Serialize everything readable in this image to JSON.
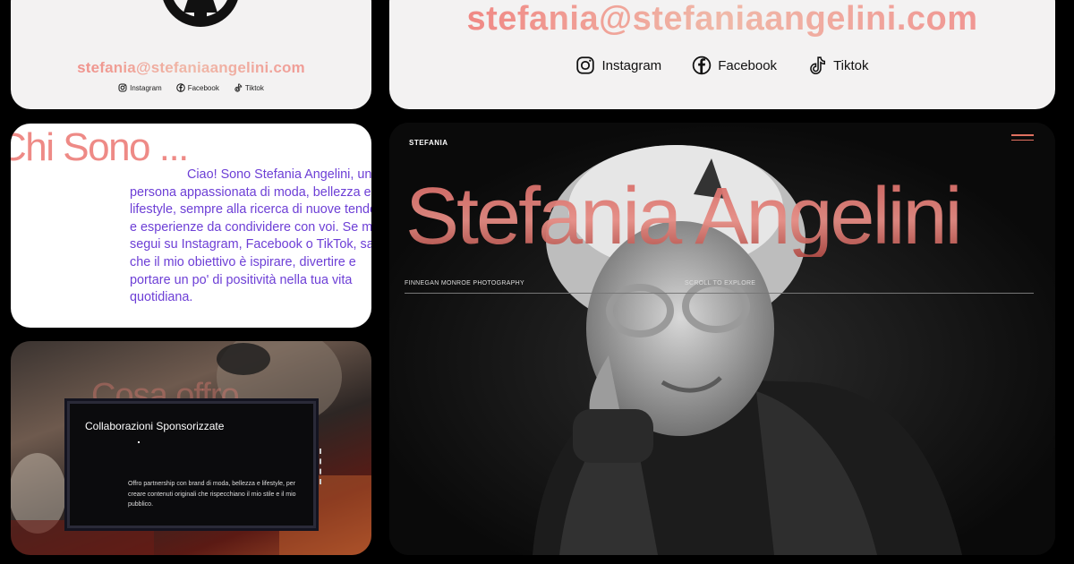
{
  "contact_small": {
    "email": "stefania@stefaniaangelini.com",
    "socials": [
      {
        "label": "Instagram",
        "icon": "instagram-icon"
      },
      {
        "label": "Facebook",
        "icon": "facebook-icon"
      },
      {
        "label": "Tiktok",
        "icon": "tiktok-icon"
      }
    ]
  },
  "contact_large": {
    "email": "stefania@stefaniaangelini.com",
    "socials": [
      {
        "label": "Instagram",
        "icon": "instagram-icon"
      },
      {
        "label": "Facebook",
        "icon": "facebook-icon"
      },
      {
        "label": "Tiktok",
        "icon": "tiktok-icon"
      }
    ]
  },
  "about": {
    "heading": "Chi Sono ...",
    "lines": [
      "                Ciao! Sono Stefania Angelini, una",
      "persona appassionata di moda, bellezza e",
      "lifestyle, sempre alla ricerca di nuove tendenze",
      "e esperienze da condividere con voi. Se mi",
      "segui su Instagram, Facebook o TikTok, sai",
      "che il mio obiettivo è ispirare, divertire e",
      "portare un po' di positività nella tua vita",
      "quotidiana."
    ]
  },
  "services": {
    "bg_title": "Cosa offro",
    "card_title": "Collaborazioni Sponsorizzate",
    "card_text": "Offro partnership con brand di moda, bellezza e lifestyle, per creare contenuti originali che rispecchiano il mio stile e il mio pubblico."
  },
  "hero": {
    "brand": "STEFANIA",
    "title": "Stefania Angelini",
    "credit": "FINNEGAN MONROE PHOTOGRAPHY",
    "explore": "SCROLL TO EXPLORE"
  },
  "colors": {
    "accent": "#ee8a86",
    "about_text": "#6d3fd6",
    "card_bg": "#f3f2f2"
  }
}
